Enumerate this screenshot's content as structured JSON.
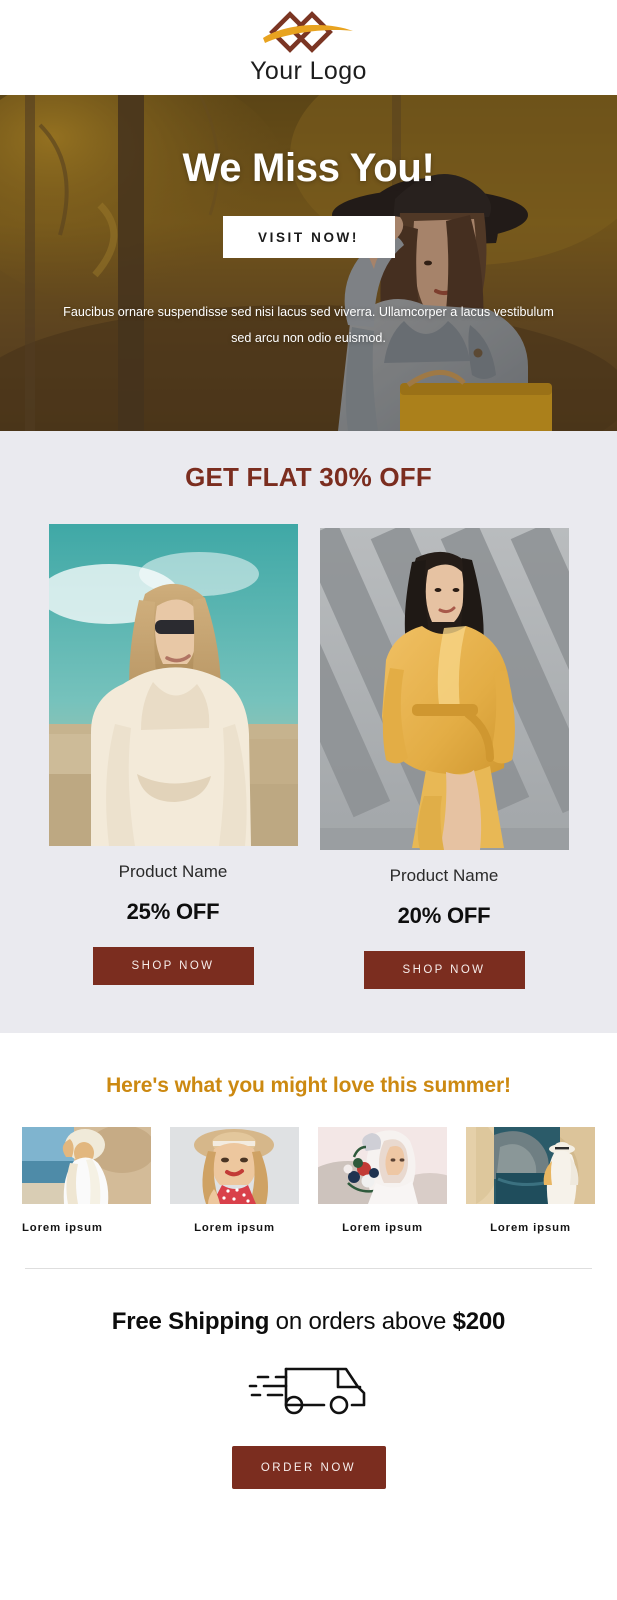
{
  "brand": {
    "logo_text": "Your Logo",
    "logo_mark": "diamond-swoosh-logo",
    "primary_color": "#7b2d1f",
    "accent_color": "#cc8911",
    "gold_color": "#e9a426"
  },
  "hero": {
    "title": "We Miss You!",
    "cta_label": "VISIT NOW!",
    "subtitle": "Faucibus ornare suspendisse sed nisi lacus sed viverra. Ullamcorper a lacus vestibulum sed arcu non odio euismod.",
    "background_image": "woman-in-hat-autumn-forest"
  },
  "offer": {
    "title": "GET FLAT 30% OFF",
    "products": [
      {
        "image": "woman-in-white-blouse-sunglasses",
        "name": "Product Name",
        "discount": "25% OFF",
        "cta_label": "SHOP NOW"
      },
      {
        "image": "woman-in-yellow-dress-shadow-wall",
        "name": "Product Name",
        "discount": "20% OFF",
        "cta_label": "SHOP NOW"
      }
    ]
  },
  "summer": {
    "title": "Here's what you might love this summer!",
    "items": [
      {
        "image": "woman-white-dress-beach",
        "caption": "Lorem ipsum"
      },
      {
        "image": "woman-red-polka-dot-hat",
        "caption": "Lorem ipsum"
      },
      {
        "image": "bride-with-bouquet",
        "caption": "Lorem ipsum"
      },
      {
        "image": "woman-at-seaside-cliff",
        "caption": "Lorem ipsum"
      }
    ]
  },
  "shipping": {
    "text_bold_1": "Free Shipping",
    "text_mid": " on orders above ",
    "text_bold_2": "$200",
    "icon": "delivery-truck-icon",
    "cta_label": "ORDER NOW"
  }
}
